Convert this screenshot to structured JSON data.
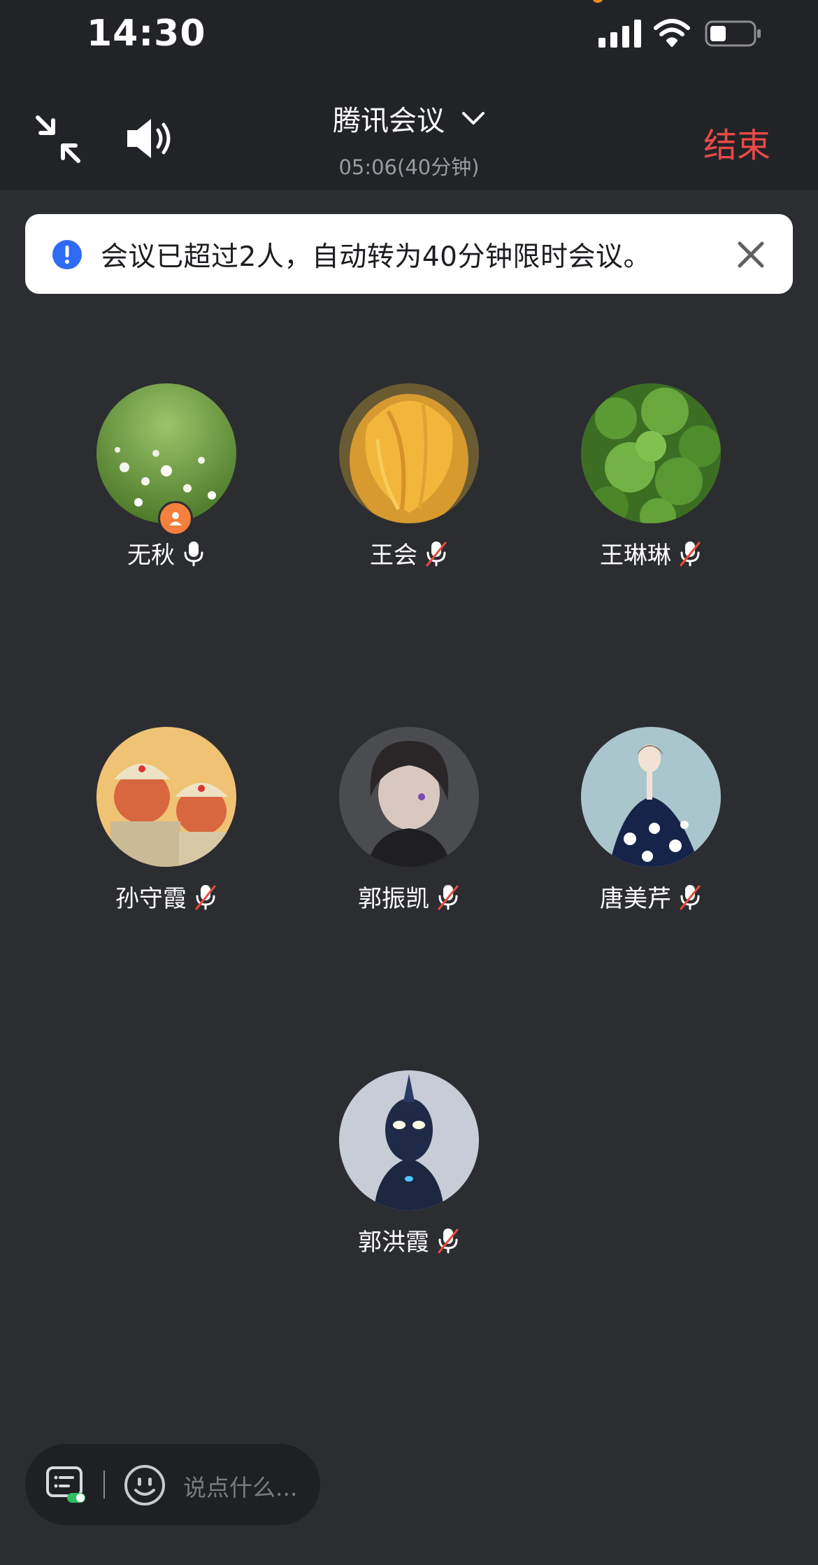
{
  "status_bar": {
    "time": "14:30",
    "icons": [
      "signal-icon",
      "wifi-icon",
      "battery-icon"
    ]
  },
  "header": {
    "app_title": "腾讯会议",
    "subtitle": "05:06(40分钟)",
    "end_label": "结束",
    "icons": [
      "shrink-icon",
      "speaker-icon",
      "chevron-down-icon"
    ]
  },
  "banner": {
    "text": "会议已超过2人，自动转为40分钟限时会议。",
    "icons": [
      "info-icon",
      "close-icon"
    ]
  },
  "participants": [
    {
      "name": "无秋",
      "mic": "on",
      "host": true
    },
    {
      "name": "王会",
      "mic": "muted"
    },
    {
      "name": "王琳琳",
      "mic": "muted"
    },
    {
      "name": "孙守霞",
      "mic": "muted"
    },
    {
      "name": "郭振凯",
      "mic": "muted"
    },
    {
      "name": "唐美芹",
      "mic": "muted"
    },
    {
      "name": "郭洪霞",
      "mic": "muted"
    }
  ],
  "chat": {
    "placeholder": "说点什么...",
    "icons": [
      "chat-list-icon",
      "emoji-icon"
    ]
  },
  "colors": {
    "background": "#2c2d31",
    "bar": "#222327",
    "end_red": "#ea4a47",
    "info_blue": "#2f6bf2",
    "host_orange": "#f57f3c"
  }
}
